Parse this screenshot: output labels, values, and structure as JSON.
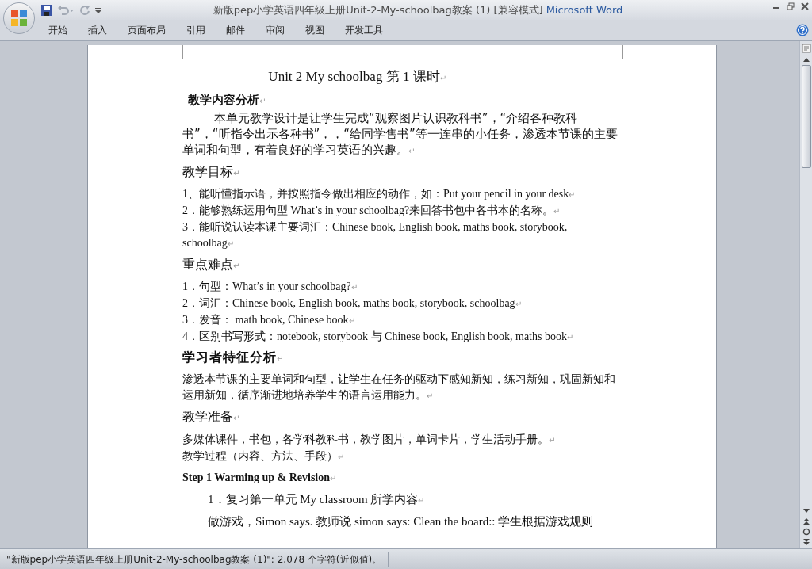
{
  "window": {
    "title": "新版pep小学英语四年级上册Unit-2-My-schoolbag教案 (1) [兼容模式]",
    "app_name": "Microsoft Word"
  },
  "ribbon_tabs": [
    {
      "label": "开始",
      "selected": false
    },
    {
      "label": "插入",
      "selected": false
    },
    {
      "label": "页面布局",
      "selected": false
    },
    {
      "label": "引用",
      "selected": false
    },
    {
      "label": "邮件",
      "selected": false
    },
    {
      "label": "审阅",
      "selected": false
    },
    {
      "label": "视图",
      "selected": false
    },
    {
      "label": "开发工具",
      "selected": false
    }
  ],
  "document": {
    "paragraph_mark": "↵",
    "paragraphs": [
      {
        "kind": "title",
        "text": "Unit 2 My schoolbag 第 1 课时"
      },
      {
        "kind": "bold_heading",
        "text": "教学内容分析"
      },
      {
        "kind": "indented",
        "text": "本单元教学设计是让学生完成“观察图片认识教科书”，“介绍各种教科书”，“听指令出示各种书”，，“给同学售书”等一连串的小任务，渗透本节课的主要单词和句型，有着良好的学习英语的兴趣。"
      },
      {
        "kind": "heading",
        "text": "教学目标"
      },
      {
        "kind": "body",
        "text": "1、能听懂指示语，并按照指令做出相应的动作，如：Put your pencil in your desk"
      },
      {
        "kind": "body",
        "text": "2．能够熟练运用句型 What’s in your schoolbag?来回答书包中各书本的名称。"
      },
      {
        "kind": "body",
        "text": "3．能听说认读本课主要词汇：Chinese book, English book, maths book, storybook, schoolbag"
      },
      {
        "kind": "heading",
        "text": "重点难点"
      },
      {
        "kind": "body",
        "text": "1．句型：What’s in your schoolbag?"
      },
      {
        "kind": "body",
        "text": "2．词汇：Chinese book, English book, maths book, storybook, schoolbag"
      },
      {
        "kind": "body",
        "text": "3．发音： math book, Chinese book"
      },
      {
        "kind": "body",
        "text": "4．区别书写形式：notebook, storybook 与 Chinese book, English book, maths book"
      },
      {
        "kind": "big_heading",
        "text": "学习者特征分析"
      },
      {
        "kind": "body",
        "text": "渗透本节课的主要单词和句型，让学生在任务的驱动下感知新知，练习新知，巩固新知和运用新知，循序渐进地培养学生的语言运用能力。"
      },
      {
        "kind": "heading",
        "text": "教学准备"
      },
      {
        "kind": "tight",
        "text": "多媒体课件，书包，各学科教科书，教学图片，单词卡片，学生活动手册。"
      },
      {
        "kind": "body",
        "text": "教学过程（内容、方法、手段）"
      },
      {
        "kind": "step",
        "text": "Step 1 Warming up & Revision"
      },
      {
        "kind": "list_indent",
        "text": "1．复习第一单元 My classroom 所学内容"
      },
      {
        "kind": "cut",
        "text": "做游戏，Simon says. 教师说 simon says: Clean the board:: 学生根据游戏规则"
      }
    ]
  },
  "status_bar": {
    "text": "\"新版pep小学英语四年级上册Unit-2-My-schoolbag教案 (1)\": 2,078 个字符(近似值)。"
  }
}
